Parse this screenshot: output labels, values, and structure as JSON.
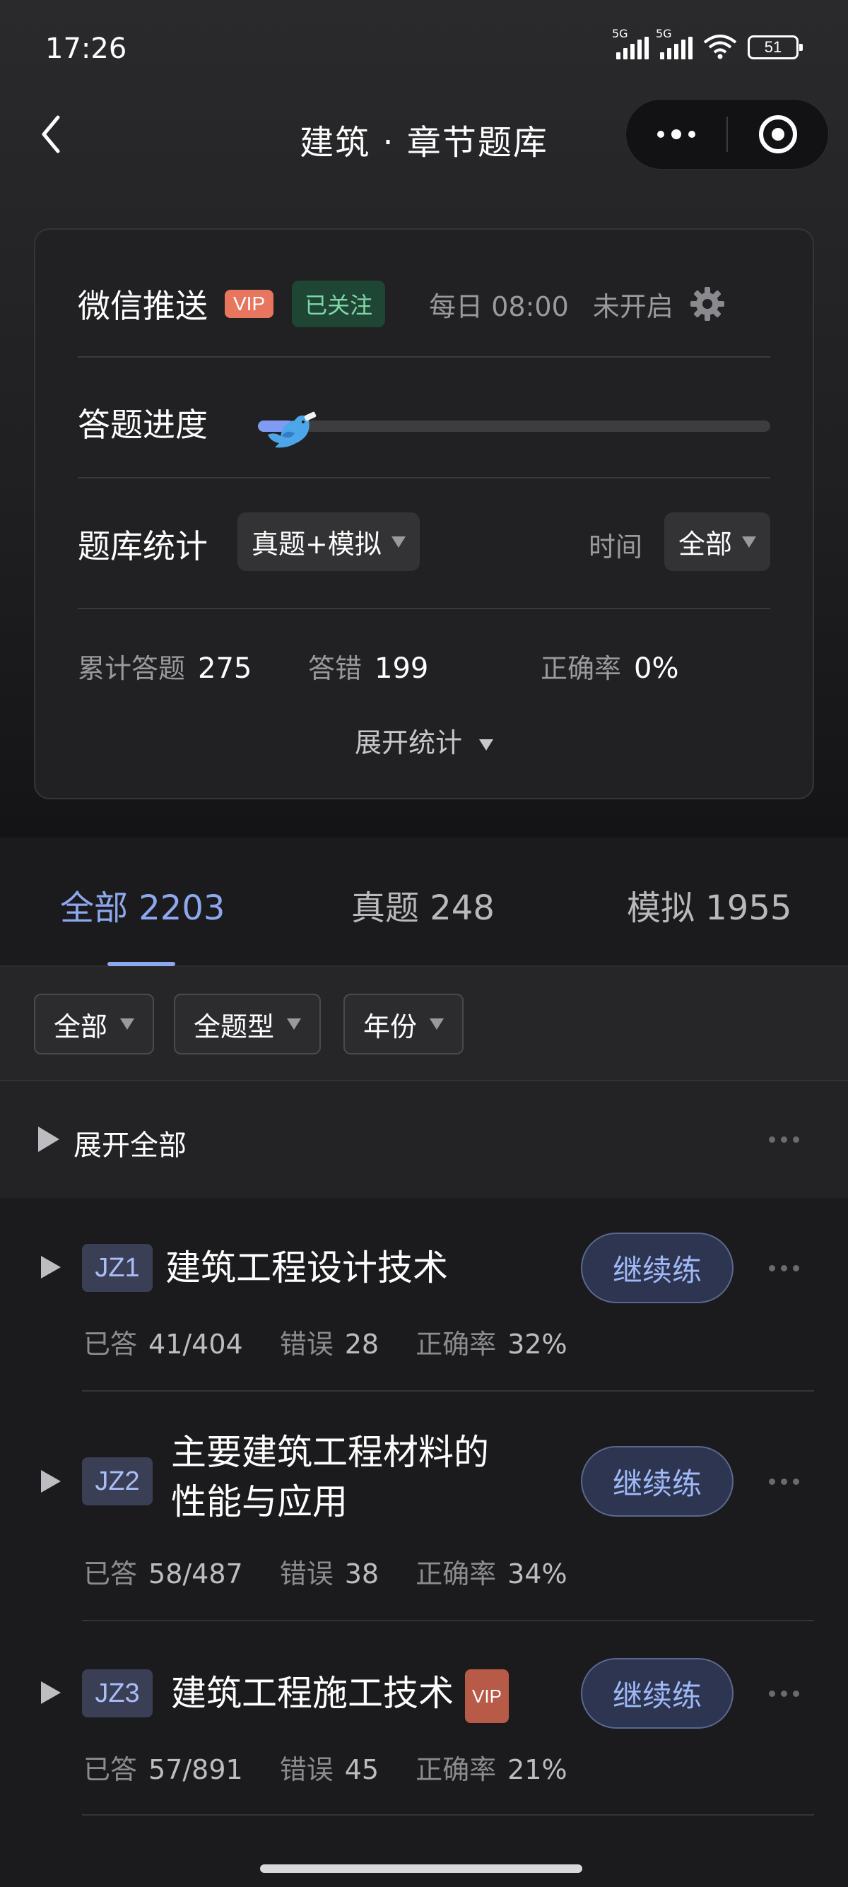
{
  "status_bar": {
    "time": "17:26",
    "sim1": "5G",
    "sim2": "5G",
    "battery": "51"
  },
  "nav": {
    "title": "建筑 · 章节题库"
  },
  "card": {
    "push_label": "微信推送",
    "vip_badge": "VIP",
    "followed_badge": "已关注",
    "daily_time": "每日 08:00",
    "push_status": "未开启",
    "progress_label": "答题进度",
    "progress_fraction": 0.07,
    "stats_label": "题库统计",
    "bank_filter": "真题+模拟",
    "time_label": "时间",
    "time_filter": "全部",
    "total_label": "累计答题",
    "total_value": "275",
    "wrong_label": "答错",
    "wrong_value": "199",
    "accuracy_label": "正确率",
    "accuracy_value": "0%",
    "expand_stats": "展开统计"
  },
  "tabs": [
    {
      "label": "全部 2203",
      "active": true
    },
    {
      "label": "真题 248",
      "active": false
    },
    {
      "label": "模拟 1955",
      "active": false
    }
  ],
  "filters": [
    "全部",
    "全题型",
    "年份"
  ],
  "expand_all": "展开全部",
  "chapter_stat_labels": {
    "answered": "已答",
    "errors": "错误",
    "accuracy": "正确率"
  },
  "continue_label": "继续练",
  "chapters": [
    {
      "code": "JZ1",
      "title": "建筑工程设计技术",
      "answered": "41/404",
      "errors": "28",
      "accuracy": "32%"
    },
    {
      "code": "JZ2",
      "title_line1": "主要建筑工程材料的",
      "title_line2": "性能与应用",
      "answered": "58/487",
      "errors": "38",
      "accuracy": "34%"
    },
    {
      "code": "JZ3",
      "title": "建筑工程施工技术",
      "vip": "VIP",
      "answered": "57/891",
      "errors": "45",
      "accuracy": "21%"
    }
  ],
  "colors": {
    "accent": "#8ea8ef",
    "vip": "#e8765f",
    "followed": "#7fd7a7",
    "background": "#1b1b1d"
  },
  "icons": [
    "back-arrow-icon",
    "more-dots-icon",
    "target-icon",
    "gear-icon",
    "bird-icon",
    "dropdown-triangle-icon",
    "play-triangle-icon",
    "gray-dots-icon"
  ]
}
